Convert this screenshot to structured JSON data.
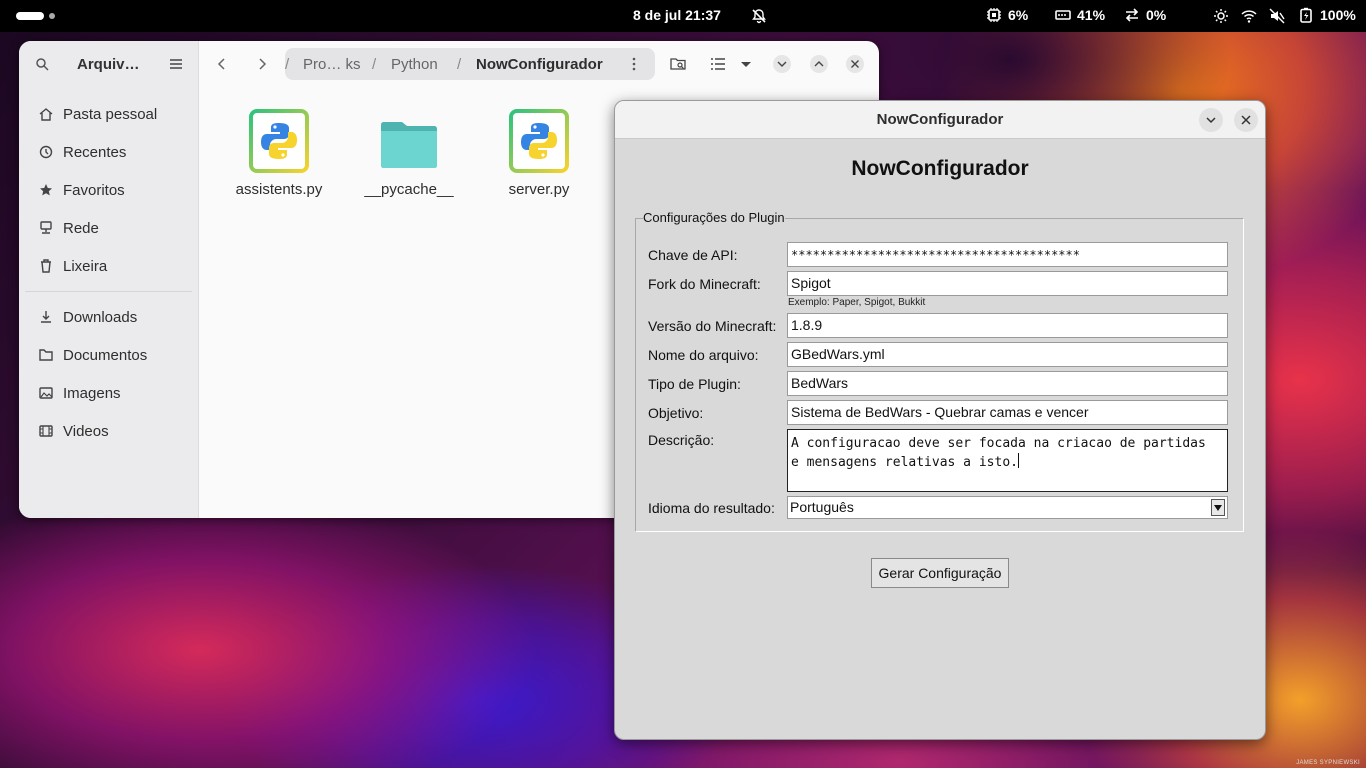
{
  "topbar": {
    "clock": "8 de jul  21:37",
    "cpu": "6%",
    "memory": "41%",
    "network": "0%",
    "battery": "100%"
  },
  "file_manager": {
    "title": "Arquiv…",
    "sidebar_places": [
      {
        "label": "Pasta pessoal",
        "icon": "home-icon"
      },
      {
        "label": "Recentes",
        "icon": "clock-icon"
      },
      {
        "label": "Favoritos",
        "icon": "star-icon"
      },
      {
        "label": "Rede",
        "icon": "network-icon"
      },
      {
        "label": "Lixeira",
        "icon": "trash-icon"
      }
    ],
    "sidebar_folders": [
      {
        "label": "Downloads",
        "icon": "download-icon"
      },
      {
        "label": "Documentos",
        "icon": "document-icon"
      },
      {
        "label": "Imagens",
        "icon": "image-icon"
      },
      {
        "label": "Videos",
        "icon": "video-icon"
      }
    ],
    "breadcrumb": {
      "first": "Pro… ks",
      "second": "Python",
      "current": "NowConfigurador",
      "sep": "/"
    },
    "files": [
      {
        "name": "assistents.py",
        "type": "python"
      },
      {
        "name": "__pycache__",
        "type": "folder"
      },
      {
        "name": "server.py",
        "type": "python"
      }
    ]
  },
  "dialog": {
    "title": "NowConfigurador",
    "heading": "NowConfigurador",
    "group_label": "Configurações do Plugin",
    "fields": {
      "api_key_label": "Chave de API:",
      "api_key_value": "****************************************",
      "fork_label": "Fork do Minecraft:",
      "fork_value": "Spigot",
      "fork_hint": "Exemplo: Paper, Spigot, Bukkit",
      "version_label": "Versão do Minecraft:",
      "version_value": "1.8.9",
      "filename_label": "Nome do arquivo:",
      "filename_value": "GBedWars.yml",
      "plugin_type_label": "Tipo de Plugin:",
      "plugin_type_value": "BedWars",
      "objective_label": "Objetivo:",
      "objective_value": "Sistema de BedWars - Quebrar camas e vencer",
      "description_label": "Descrição:",
      "description_line1": "A configuracao deve ser focada na criacao de partidas",
      "description_line2": "e mensagens relativas a isto.",
      "language_label": "Idioma do resultado:",
      "language_value": "Português"
    },
    "generate_button": "Gerar Configuração"
  },
  "wallpaper_credit": "JAMES SYPNIEWSKI"
}
